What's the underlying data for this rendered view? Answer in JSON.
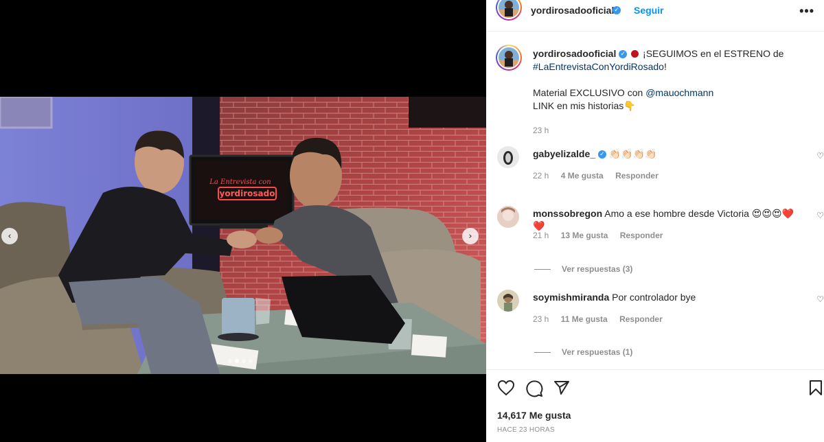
{
  "post": {
    "username": "yordirosadooficial",
    "follow_label": "Seguir",
    "more_label": "•••",
    "verified_mark": "✓",
    "media": {
      "screen_text": "La Entrevista con yordirosado",
      "prev_arrow": "‹",
      "next_arrow": "›",
      "dots_count": 4,
      "active_dot": 1
    },
    "caption": {
      "username": "yordirosadooficial",
      "line1_text": "¡SEGUIMOS en el ESTRENO de",
      "hashtag": "#LaEntrevistaConYordiRosado",
      "line1_end": "!",
      "line2_text": "Material EXCLUSIVO con",
      "mention": "@mauochmann",
      "line3_text": "LINK en mis historias👇",
      "time": "23 h"
    },
    "comments": [
      {
        "username": "gabyelizalde_",
        "text": "👏🏻👏🏻👏🏻👏🏻",
        "time": "22 h",
        "likes": "4 Me gusta",
        "reply": "Responder",
        "verified": true
      },
      {
        "username": "monssobregon",
        "text": "Amo a ese hombre desde Victoria 😍😍😍❤️❤️",
        "time": "21 h",
        "likes": "13 Me gusta",
        "reply": "Responder",
        "replies": "Ver respuestas (3)"
      },
      {
        "username": "soymishmiranda",
        "text": "Por controlador bye",
        "time": "23 h",
        "likes": "11 Me gusta",
        "reply": "Responder",
        "replies": "Ver respuestas (1)"
      }
    ],
    "likes": "14,617 Me gusta",
    "posted_ago": "HACE 23 HORAS",
    "icons": {
      "heart": "heart-icon",
      "comment": "comment-icon",
      "share": "share-icon",
      "save": "bookmark-icon"
    }
  }
}
